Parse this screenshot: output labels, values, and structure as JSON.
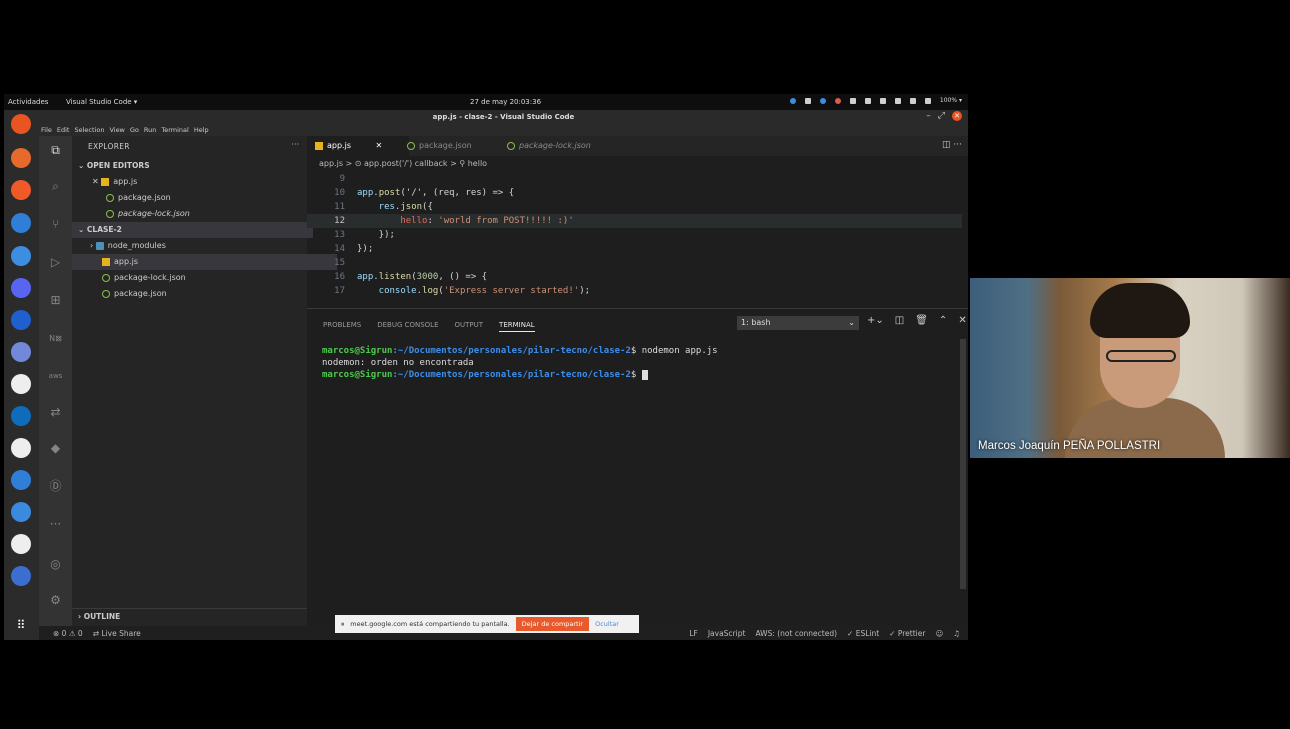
{
  "gnome": {
    "activities": "Actividades",
    "app": "Visual Studio Code ▾",
    "clock": "27 de may  20:03:36",
    "battery": "100% ▾"
  },
  "window": {
    "title": "app.js - clase-2 - Visual Studio Code",
    "controls": [
      "–",
      "⤢"
    ]
  },
  "menu": [
    "File",
    "Edit",
    "Selection",
    "View",
    "Go",
    "Run",
    "Terminal",
    "Help"
  ],
  "sidebar": {
    "header": "EXPLORER",
    "more": "···",
    "open_editors_label": "OPEN EDITORS",
    "open_editors": [
      {
        "name": "app.js",
        "prefix": "✕"
      },
      {
        "name": "package.json",
        "prefix": ""
      },
      {
        "name": "package-lock.json",
        "prefix": ""
      }
    ],
    "folder_label": "CLASE-2",
    "files": [
      {
        "name": "node_modules",
        "prefix": "›"
      },
      {
        "name": "app.js",
        "prefix": ""
      },
      {
        "name": "package-lock.json",
        "prefix": ""
      },
      {
        "name": "package.json",
        "prefix": ""
      }
    ],
    "outline": "OUTLINE"
  },
  "tabs": [
    {
      "label": "app.js",
      "close": "✕"
    },
    {
      "label": "package.json",
      "close": ""
    },
    {
      "label": "package-lock.json",
      "close": ""
    }
  ],
  "breadcrumb": "app.js > ⊙ app.post('/') callback > ⚲ hello",
  "code": {
    "line_numbers": [
      "9",
      "10",
      "11",
      "12",
      "13",
      "14",
      "15",
      "16",
      "17"
    ],
    "l10a": "app.",
    "l10b": "post",
    "l10c": "('/', (req, res) => {",
    "l11a": "    res.",
    "l11b": "json",
    "l11c": "({",
    "l12a": "        hello",
    "l12b": ": ",
    "l12c": "'world from POST!!!!! :)'",
    "l13": "    });",
    "l14": "});",
    "l16a": "app.",
    "l16b": "listen",
    "l16c": "(",
    "l16d": "3000",
    "l16e": ", () => {",
    "l17a": "    console.",
    "l17b": "log",
    "l17c": "(",
    "l17d": "'Express server started!'",
    "l17e": ");"
  },
  "panel": {
    "tabs": [
      "PROBLEMS",
      "DEBUG CONSOLE",
      "OUTPUT",
      "TERMINAL"
    ],
    "shell": "1: bash",
    "terminal": {
      "user": "marcos@Sigrun",
      "path": ":~/Documentos/personales/pilar-tecno/clase-2",
      "cmd1": "$ nodemon app.js",
      "out1": "nodemon: orden no encontrada",
      "cmd2": "$ "
    }
  },
  "status": {
    "problems": "⊗ 0 ⚠ 0",
    "live_share": "Live Share",
    "right": [
      "LF",
      "JavaScript",
      "AWS: (not connected)",
      "✓ ESLint",
      "✓ Prettier"
    ]
  },
  "share_banner": {
    "text": "meet.google.com está compartiendo tu pantalla.",
    "stop": "Dejar de compartir",
    "hide": "Ocultar"
  },
  "webcam": {
    "name": "Marcos Joaquín PEÑA POLLASTRI"
  }
}
